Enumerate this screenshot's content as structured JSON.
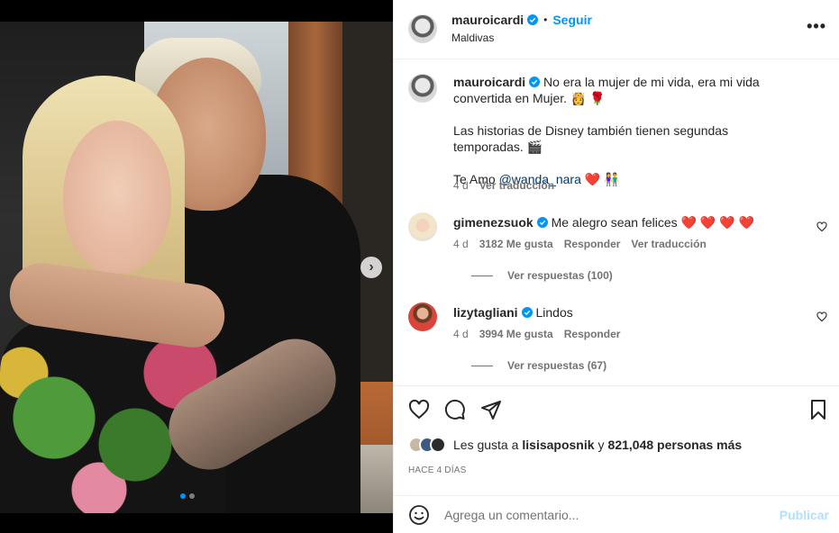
{
  "post": {
    "username": "mauroicardi",
    "follow_label": "Seguir",
    "separator": "•",
    "location": "Maldivas",
    "more_label": "•••",
    "carousel_next": "›",
    "carousel_total": 2
  },
  "caption": {
    "username": "mauroicardi",
    "line1": "No era la mujer de mi vida, era mi vida convertida en Mujer. 👸 🌹",
    "line2": "Las historias de Disney también tienen segundas temporadas. 🎬",
    "line3_prefix": "Te Amo ",
    "mention": "@wanda_nara",
    "line3_suffix": " ❤️ 👫",
    "age": "4 d",
    "translate_label": "Ver traducción"
  },
  "comments": [
    {
      "username": "gimenezsuok",
      "text": "Me alegro sean felices ❤️ ❤️ ❤️ ❤️",
      "age": "4 d",
      "likes": "3182 Me gusta",
      "reply_label": "Responder",
      "translate_label": "Ver traducción",
      "replies_label": "Ver respuestas (100)"
    },
    {
      "username": "lizytagliani",
      "text": "Lindos",
      "age": "4 d",
      "likes": "3994 Me gusta",
      "reply_label": "Responder",
      "replies_label": "Ver respuestas (67)"
    }
  ],
  "likes": {
    "prefix": "Les gusta a ",
    "user": "lisisaposnik",
    "middle": " y ",
    "count": "821,048 personas más"
  },
  "timestamp": "HACE 4 DÍAS",
  "add_comment": {
    "placeholder": "Agrega un comentario...",
    "publish_label": "Publicar"
  },
  "colors": {
    "accent": "#0095f6",
    "verified": "#0095f6",
    "muted": "#737373",
    "publish_disabled": "#b2dffc"
  }
}
